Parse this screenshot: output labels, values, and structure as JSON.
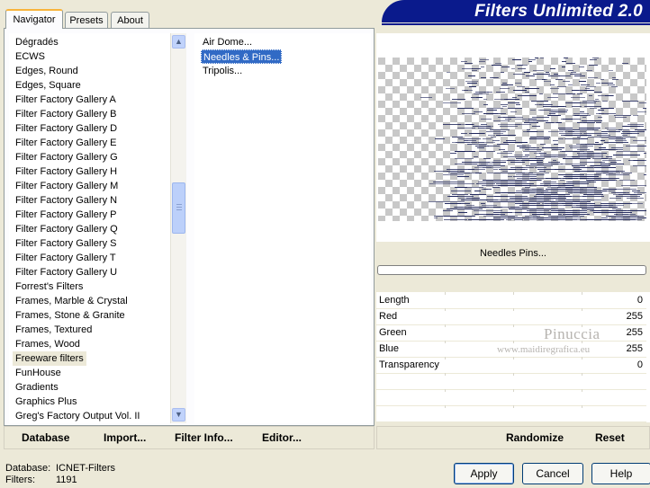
{
  "tabs": [
    "Navigator",
    "Presets",
    "About"
  ],
  "title": "Filters Unlimited 2.0",
  "categories": [
    "Dégradés",
    "ECWS",
    "Edges, Round",
    "Edges, Square",
    "Filter Factory Gallery A",
    "Filter Factory Gallery B",
    "Filter Factory Gallery D",
    "Filter Factory Gallery E",
    "Filter Factory Gallery G",
    "Filter Factory Gallery H",
    "Filter Factory Gallery M",
    "Filter Factory Gallery N",
    "Filter Factory Gallery P",
    "Filter Factory Gallery Q",
    "Filter Factory Gallery S",
    "Filter Factory Gallery T",
    "Filter Factory Gallery U",
    "Forrest's Filters",
    "Frames, Marble & Crystal",
    "Frames, Stone & Granite",
    "Frames, Textured",
    "Frames, Wood",
    "Freeware filters",
    "FunHouse",
    "Gradients",
    "Graphics Plus",
    "Greg's Factory Output Vol. II"
  ],
  "selected_category": "Freeware filters",
  "filters": [
    "Air Dome...",
    "Needles & Pins...",
    "Tripolis..."
  ],
  "selected_filter": "Needles & Pins...",
  "preview_filter_name": "Needles  Pins...",
  "params": [
    {
      "label": "Length",
      "value": "0"
    },
    {
      "label": "Red",
      "value": "255"
    },
    {
      "label": "Green",
      "value": "255"
    },
    {
      "label": "Blue",
      "value": "255"
    },
    {
      "label": "Transparency",
      "value": "0"
    }
  ],
  "watermark": {
    "line1": "Pinuccia",
    "line2": "www.maidiregrafica.eu"
  },
  "left_buttons": [
    "Database",
    "Import...",
    "Filter Info...",
    "Editor..."
  ],
  "right_buttons": [
    "Randomize",
    "Reset"
  ],
  "footer": {
    "database_label": "Database:",
    "database_value": "ICNET-Filters",
    "filters_label": "Filters:",
    "filters_value": "1191"
  },
  "actions": [
    "Apply",
    "Cancel",
    "Help"
  ],
  "colors": {
    "banner": "#0a1a8c",
    "selection": "#316ac5",
    "face": "#ece9d8",
    "needles": "#1b2258"
  },
  "icons": {
    "scroll_up": "chevron-up-icon",
    "scroll_down": "chevron-down-icon"
  }
}
